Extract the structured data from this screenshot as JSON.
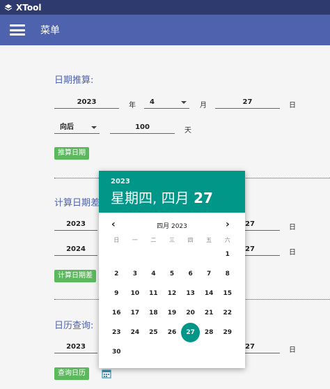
{
  "window": {
    "title": "XTool"
  },
  "appbar": {
    "menu_label": "菜单"
  },
  "section1": {
    "title": "日期推算:",
    "year": "2023",
    "year_unit": "年",
    "month": "4",
    "month_unit": "月",
    "day": "27",
    "day_unit": "日",
    "direction": "向后",
    "offset": "100",
    "offset_unit": "天",
    "button": "推算日期"
  },
  "section2": {
    "title": "计算日期差:",
    "row1": {
      "year": "2023",
      "day": "27",
      "day_unit": "日"
    },
    "row2": {
      "year": "2024",
      "day": "27",
      "day_unit": "日"
    },
    "button": "计算日期差"
  },
  "section3": {
    "title": "日历查询:",
    "year": "2023",
    "day": "27",
    "day_unit": "日",
    "button": "查询日历"
  },
  "picker": {
    "year": "2023",
    "date_prefix": "星期四, 四月 ",
    "date_day": "27",
    "month_label": "四月 2023",
    "prev": "‹",
    "next": "›",
    "weekdays": [
      "日",
      "一",
      "二",
      "三",
      "四",
      "五",
      "六"
    ],
    "weeks": [
      [
        "",
        "",
        "",
        "",
        "",
        "",
        "1"
      ],
      [
        "2",
        "3",
        "4",
        "5",
        "6",
        "7",
        "8"
      ],
      [
        "9",
        "10",
        "11",
        "12",
        "13",
        "14",
        "15"
      ],
      [
        "16",
        "17",
        "18",
        "19",
        "20",
        "21",
        "22"
      ],
      [
        "23",
        "24",
        "25",
        "26",
        "27",
        "28",
        "29"
      ],
      [
        "30",
        "",
        "",
        "",
        "",
        "",
        ""
      ]
    ],
    "selected": "27"
  },
  "colors": {
    "appbar": "#4f62ad",
    "titlebar": "#2e3a6e",
    "accent": "#009688",
    "button": "#5cb85c"
  },
  "icons": {
    "menu": "hamburger-menu-icon",
    "calendar": "calendar-icon",
    "logo": "layers-icon"
  }
}
